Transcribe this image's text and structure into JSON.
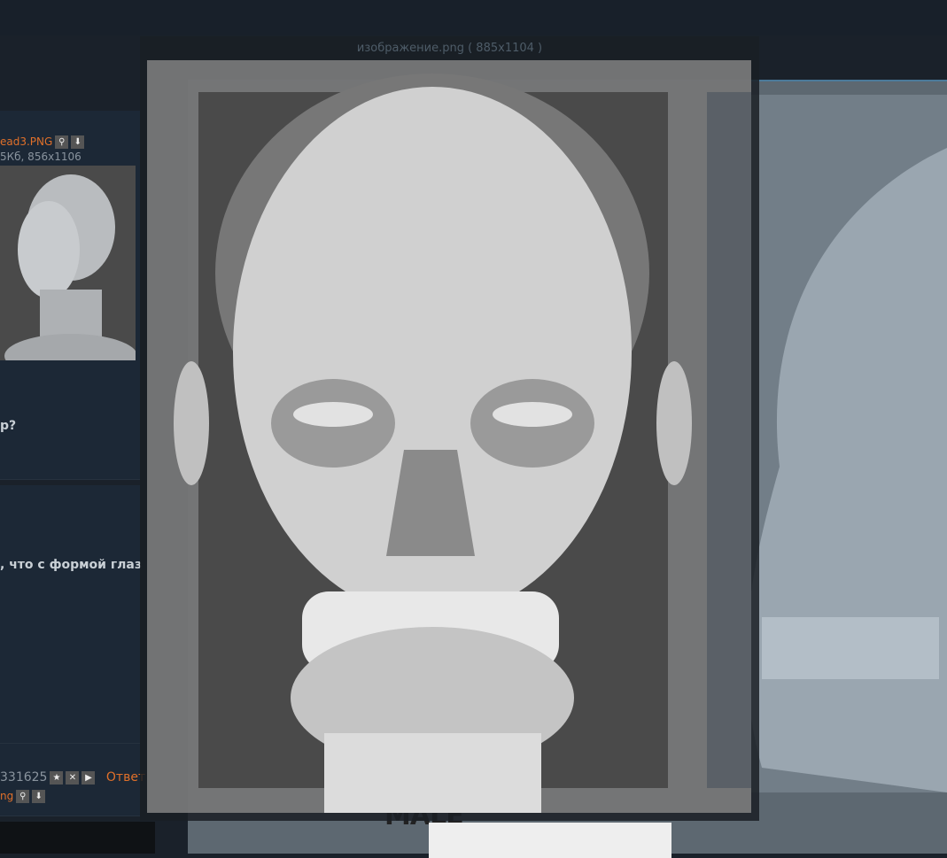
{
  "viewer": {
    "title": "изображение.png ( 885x1104 )"
  },
  "posts": [
    {
      "filename": "ead3.PNG",
      "meta": "5Кб, 856x1106",
      "text": "р?"
    },
    {
      "text": ", что с формой глаз"
    },
    {
      "number": "331625",
      "reply_label": "Ответ",
      "filename": "ng"
    }
  ],
  "background_image": {
    "label": "MALE"
  },
  "colors": {
    "accent": "#e0702a",
    "page_bg": "#1a212a",
    "post_bg": "#1c2836"
  }
}
